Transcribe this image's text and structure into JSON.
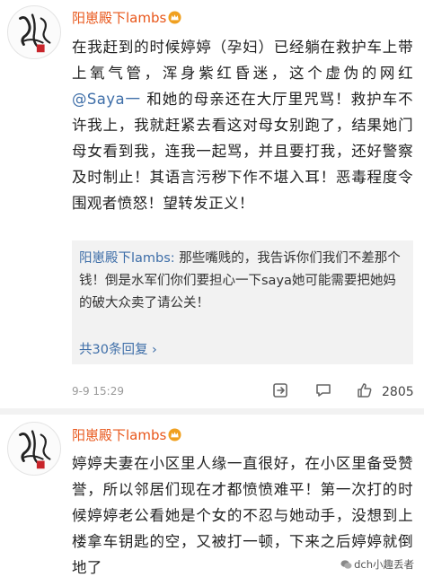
{
  "posts": [
    {
      "username": "阳崽殿下lambs",
      "text_before_mention": "在我赶到的时候婷婷（孕妇）已经躺在救护车上带上氧气管，浑身紫红昏迷，这个虚伪的网红",
      "mention": "@Saya一",
      "text_after_mention": " 和她的母亲还在大厅里咒骂！救护车不许我上，我就赶紧去看这对母女别跑了，结果她门母女看到我，连我一起骂，并且要打我，还好警察及时制止！其语言污秽下作不堪入耳！恶毒程度令围观者愤怒！望转发正义！",
      "repost": {
        "author": "阳崽殿下lambs:",
        "text": " 那些嘴贱的，我告诉你们我们不差那个钱！倒是水军们你们要担心一下saya她可能需要把她妈的破大众卖了请公关！",
        "more_link": "共30条回复 ›"
      },
      "timestamp": "9-9 15:29",
      "likes": "2805",
      "icons": [
        "repost-icon",
        "comment-icon",
        "like-icon"
      ]
    },
    {
      "username": "阳崽殿下lambs",
      "text": "婷婷夫妻在小区里人缘一直很好，在小区里备受赞誉，所以邻居们现在才都愤愤难平！第一次打的时候婷婷老公看她是个女的不忍与她动手，没想到上楼拿车钥匙的空，又被打一顿，下来之后婷婷就倒地了"
    }
  ],
  "watermark": "dch小趣丢者",
  "colors": {
    "username": "#e8561a",
    "link": "#3e6ea8",
    "repost_bg": "#f2f2f2",
    "crown": "#f0a020"
  }
}
